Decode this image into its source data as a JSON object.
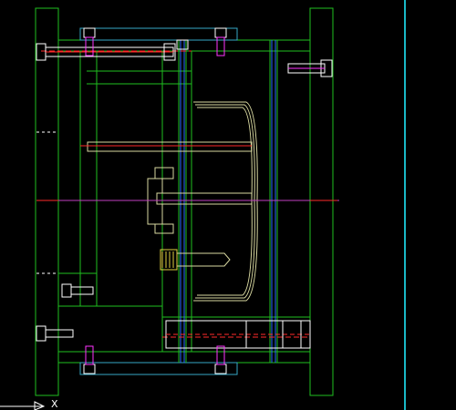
{
  "viewport": {
    "background": "#000000",
    "right_border_color": "#19b8c6"
  },
  "drawing": {
    "type": "cad-mold-assembly-section",
    "colors": {
      "outline": "#1fbf1f",
      "bolt": "#ffffff",
      "bolt_accent": "#ff33ff",
      "center_line": "#ff2a2a",
      "centerline_magenta": "#c040c0",
      "cavity": "#d8d8a0",
      "ejector_blue": "#2a6cff",
      "cyan_plate": "#36a9c6"
    }
  },
  "ucs": {
    "x_label": "X"
  }
}
